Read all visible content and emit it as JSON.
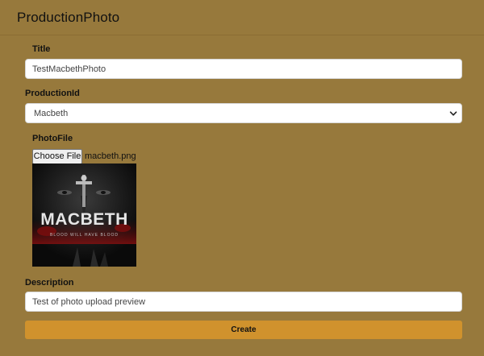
{
  "page": {
    "title": "ProductionPhoto"
  },
  "form": {
    "title_label": "Title",
    "title_value": "TestMacbethPhoto",
    "production_label": "ProductionId",
    "production_selected": "Macbeth",
    "photo_label": "PhotoFile",
    "choose_file_label": "Choose File",
    "file_name": "macbeth.png",
    "description_label": "Description",
    "description_value": "Test of photo upload preview",
    "create_label": "Create"
  },
  "preview": {
    "title_text": "MACBETH",
    "tagline": "BLOOD WILL HAVE BLOOD"
  },
  "icons": {
    "select_arrow": "chevron-down-icon"
  },
  "colors": {
    "background": "#97793c",
    "button": "#d0922d"
  }
}
